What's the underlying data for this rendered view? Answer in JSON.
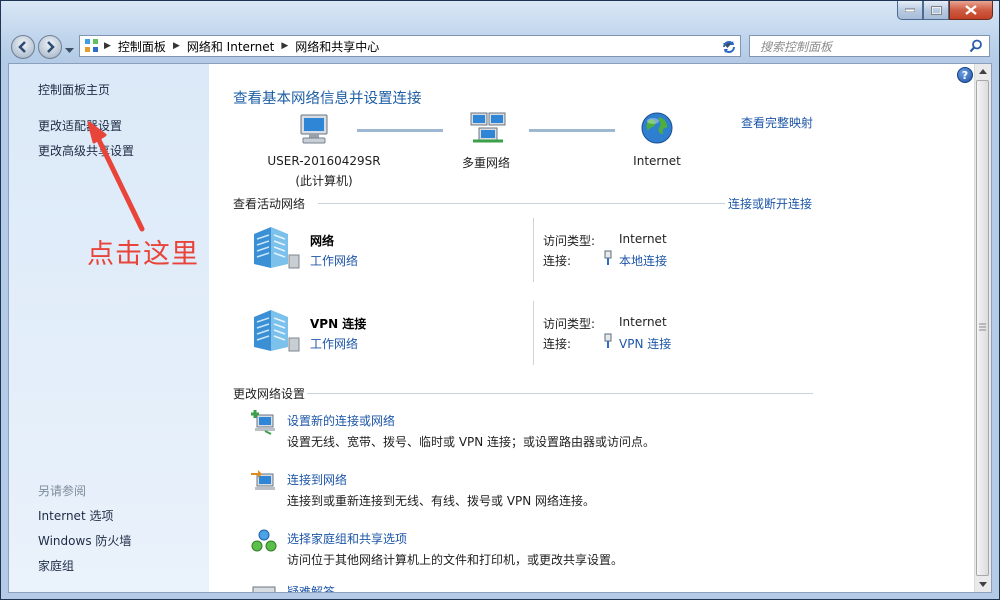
{
  "window": {
    "minimize_icon": "minimize-icon",
    "maximize_icon": "maximize-icon",
    "close_icon": "close-icon"
  },
  "breadcrumb": {
    "items": [
      "控制面板",
      "网络和 Internet",
      "网络和共享中心"
    ]
  },
  "search": {
    "placeholder": "搜索控制面板"
  },
  "sidebar": {
    "links": [
      "控制面板主页",
      "更改适配器设置",
      "更改高级共享设置"
    ],
    "see_also_title": "另请参阅",
    "see_also": [
      "Internet 选项",
      "Windows 防火墙",
      "家庭组"
    ]
  },
  "main": {
    "title": "查看基本网络信息并设置连接",
    "view_full_map": "查看完整映射",
    "map": {
      "computer_name": "USER-20160429SR",
      "computer_note": "(此计算机)",
      "multi_network": "多重网络",
      "internet": "Internet"
    },
    "active_networks": {
      "title": "查看活动网络",
      "connect_link": "连接或断开连接",
      "networks": [
        {
          "name": "网络",
          "type": "工作网络",
          "access_label": "访问类型:",
          "access_value": "Internet",
          "conn_label": "连接:",
          "conn_value": "本地连接"
        },
        {
          "name": "VPN 连接",
          "type": "工作网络",
          "access_label": "访问类型:",
          "access_value": "Internet",
          "conn_label": "连接:",
          "conn_value": "VPN 连接"
        }
      ]
    },
    "change_settings": {
      "title": "更改网络设置",
      "tasks": [
        {
          "title": "设置新的连接或网络",
          "desc": "设置无线、宽带、拨号、临时或 VPN 连接；或设置路由器或访问点。"
        },
        {
          "title": "连接到网络",
          "desc": "连接到或重新连接到无线、有线、拨号或 VPN 网络连接。"
        },
        {
          "title": "选择家庭组和共享选项",
          "desc": "访问位于其他网络计算机上的文件和打印机，或更改共享设置。"
        },
        {
          "title": "疑难解答",
          "desc": ""
        }
      ]
    }
  },
  "annotation": {
    "text": "点击这里",
    "color": "#e8443a"
  },
  "colors": {
    "link": "#1d56a8",
    "heading": "#1f5fa5",
    "sidebar_bg": "#dbe9f8"
  }
}
